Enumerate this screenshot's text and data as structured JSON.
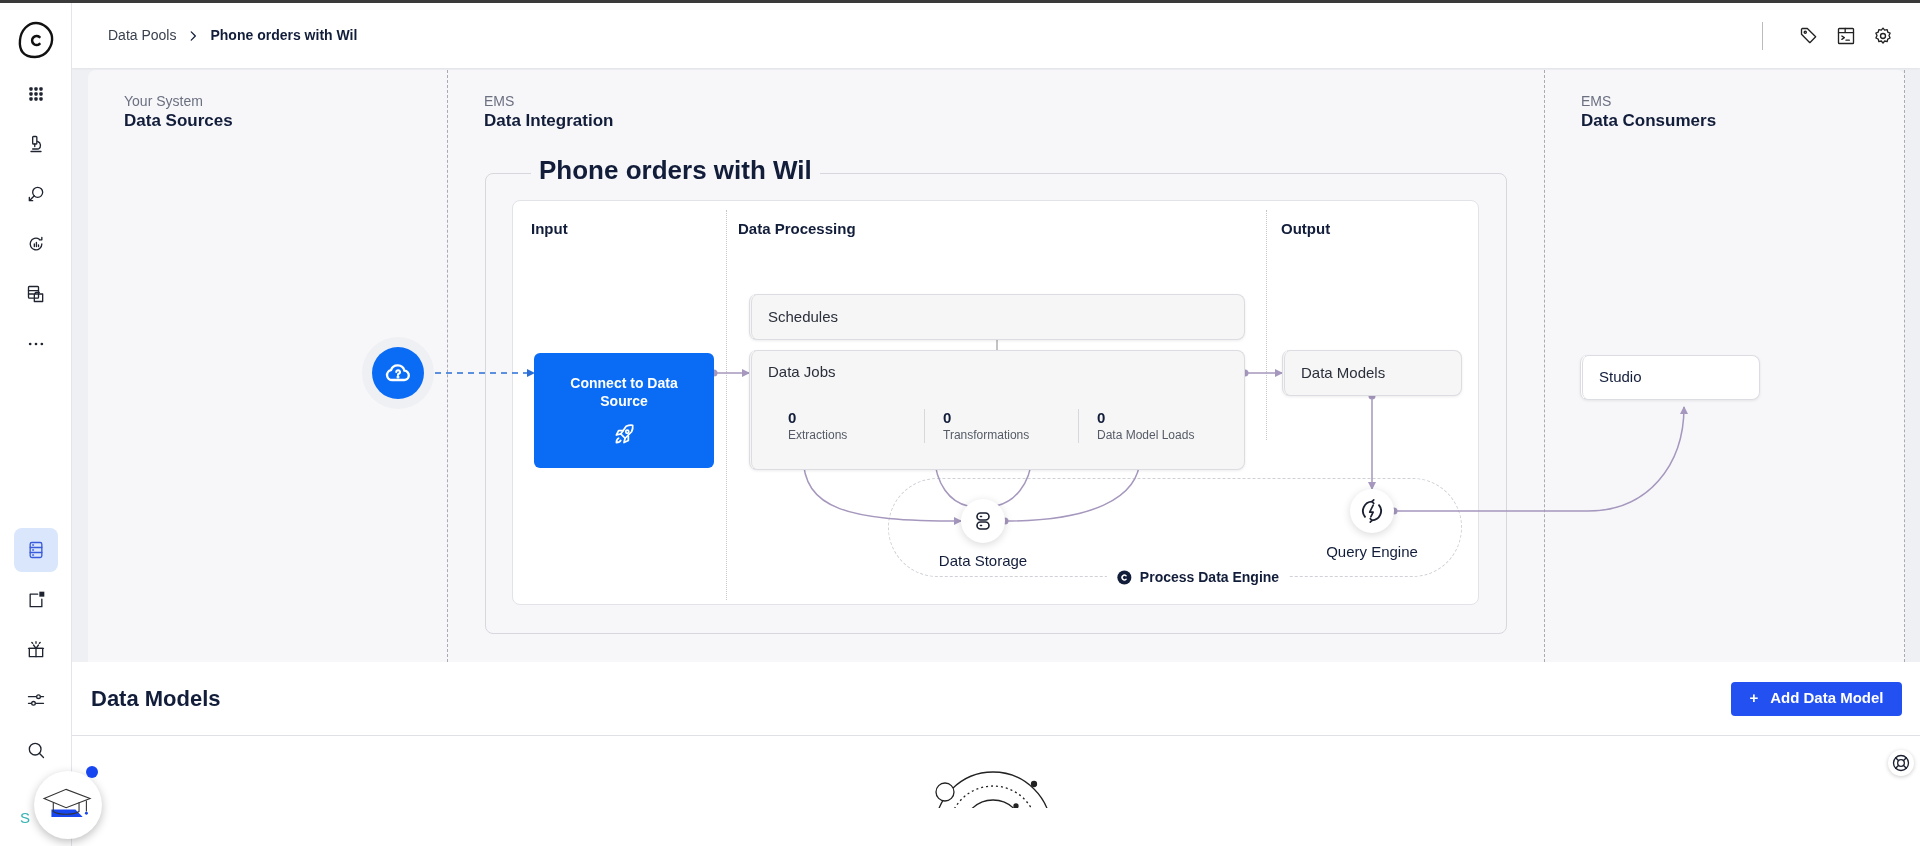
{
  "sidebar": {
    "top_items": [
      {
        "selected": false
      },
      {
        "selected": false
      },
      {
        "selected": false
      },
      {
        "selected": false
      },
      {
        "selected": false
      },
      {
        "selected": false
      }
    ],
    "bottom_items": [
      {
        "selected": true
      },
      {
        "selected": false
      },
      {
        "selected": false
      },
      {
        "selected": false
      },
      {
        "selected": false
      }
    ],
    "footer_text": "S"
  },
  "top_bar": {
    "breadcrumb": [
      {
        "label": "Data Pools",
        "current": false
      },
      {
        "label": "Phone orders with Wil",
        "current": true
      }
    ]
  },
  "overview": {
    "columns": [
      {
        "overline": "Your System",
        "title": "Data Sources"
      },
      {
        "overline": "EMS",
        "title": "Data Integration"
      },
      {
        "overline": "EMS",
        "title": "Data Consumers"
      }
    ],
    "pool": {
      "title": "Phone orders with Wil",
      "sections": [
        "Input",
        "Data Processing",
        "Output"
      ],
      "connect_button": "Connect to Data Source",
      "schedules": "Schedules",
      "data_jobs": {
        "title": "Data Jobs",
        "stats": [
          {
            "count": "0",
            "label": "Extractions"
          },
          {
            "count": "0",
            "label": "Transformations"
          },
          {
            "count": "0",
            "label": "Data Model Loads"
          }
        ]
      },
      "data_models": "Data Models",
      "data_storage": "Data Storage",
      "query_engine": "Query Engine",
      "engine_label": "Process Data Engine"
    },
    "consumers": [
      {
        "label": "Studio"
      }
    ]
  },
  "data_models_section": {
    "title": "Data Models",
    "add_button": {
      "icon": "+",
      "label": "Add Data Model"
    }
  }
}
